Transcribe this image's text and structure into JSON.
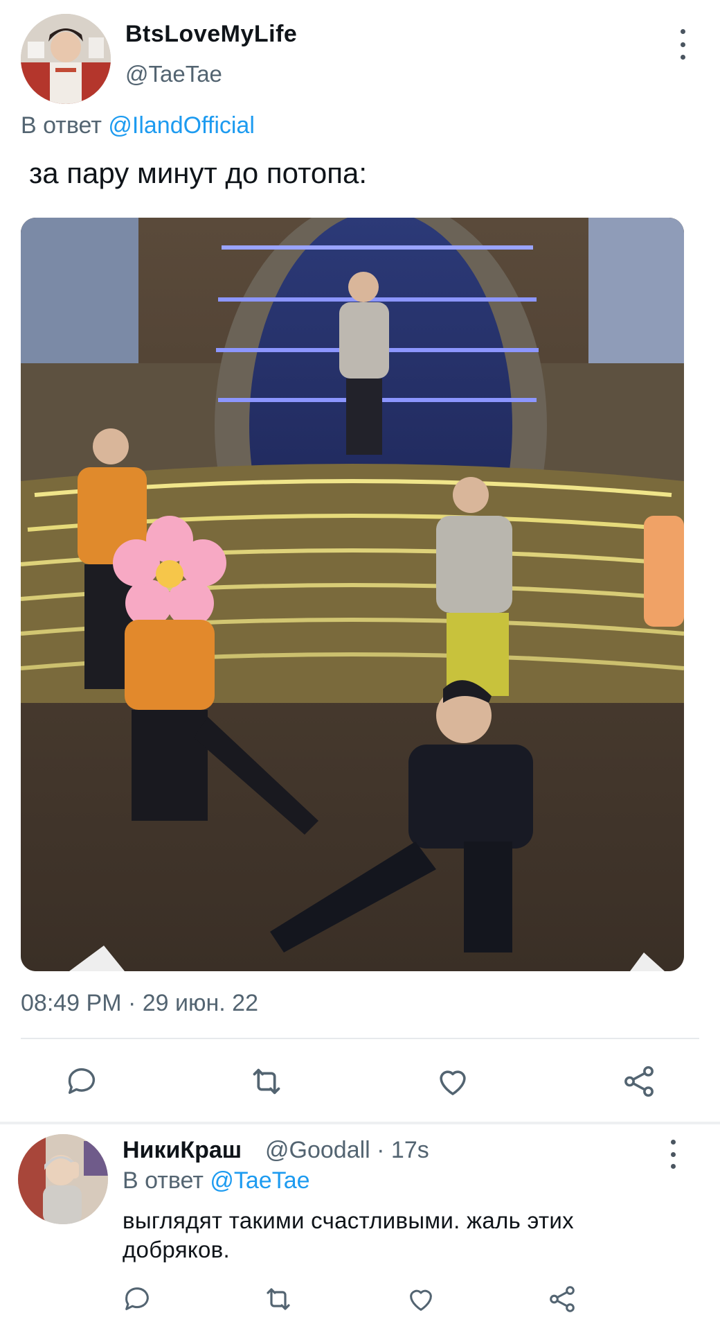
{
  "tweet": {
    "display_name": "BtsLoveMyLife",
    "handle": "@TaeTae",
    "reply_prefix": "В ответ",
    "reply_mention": "@IlandOfficial",
    "text": "за пару минут до потопа:",
    "timestamp": "08:49 PM · 29 июн. 22",
    "actions": [
      {
        "name": "reply",
        "icon": "comment-icon"
      },
      {
        "name": "retweet",
        "icon": "retweet-icon"
      },
      {
        "name": "like",
        "icon": "heart-icon"
      },
      {
        "name": "share",
        "icon": "share-icon"
      }
    ]
  },
  "reply": {
    "display_name": "НикиКраш",
    "handle_time": "@Goodall · 17s",
    "reply_prefix": "В ответ",
    "reply_mention": "@TaeTae",
    "text": "выглядят такими счастливыми. жаль этих добряков.",
    "actions": [
      {
        "name": "reply",
        "icon": "comment-icon"
      },
      {
        "name": "retweet",
        "icon": "retweet-icon"
      },
      {
        "name": "like",
        "icon": "heart-icon"
      },
      {
        "name": "share",
        "icon": "share-icon"
      }
    ]
  },
  "colors": {
    "link": "#1d9bf0",
    "secondary_text": "#536471",
    "icon": "#536471",
    "primary_text": "#0f1419"
  }
}
